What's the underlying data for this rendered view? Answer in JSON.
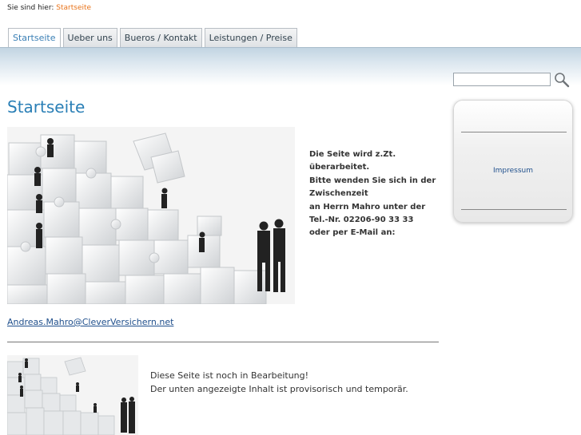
{
  "breadcrumb": {
    "prefix": "Sie sind hier:",
    "current": "Startseite"
  },
  "tabs": [
    {
      "label": "Startseite",
      "active": true
    },
    {
      "label": "Ueber uns",
      "active": false
    },
    {
      "label": "Bueros / Kontakt",
      "active": false
    },
    {
      "label": "Leistungen / Preise",
      "active": false
    }
  ],
  "search": {
    "value": "",
    "button_icon": "magnifier-icon"
  },
  "main": {
    "title": "Startseite",
    "notice_lines": [
      "Die Seite wird z.Zt.",
      "überarbeitet.",
      "Bitte wenden Sie sich in der",
      "Zwischenzeit",
      "an Herrn Mahro unter der",
      "Tel.-Nr. 02206-90 33 33",
      "oder per E-Mail an:"
    ],
    "email": "Andreas.Mahro@CleverVersichern.net",
    "bearbeitung_lines": [
      "Diese Seite ist noch in Bearbeitung!",
      "Der unten angezeigte Inhalt ist provisorisch und temporär."
    ]
  },
  "sidebar": {
    "link": "Impressum"
  },
  "colors": {
    "accent": "#2a7fb6",
    "breadcrumb_current": "#e8731a",
    "link": "#1f4f8c"
  }
}
